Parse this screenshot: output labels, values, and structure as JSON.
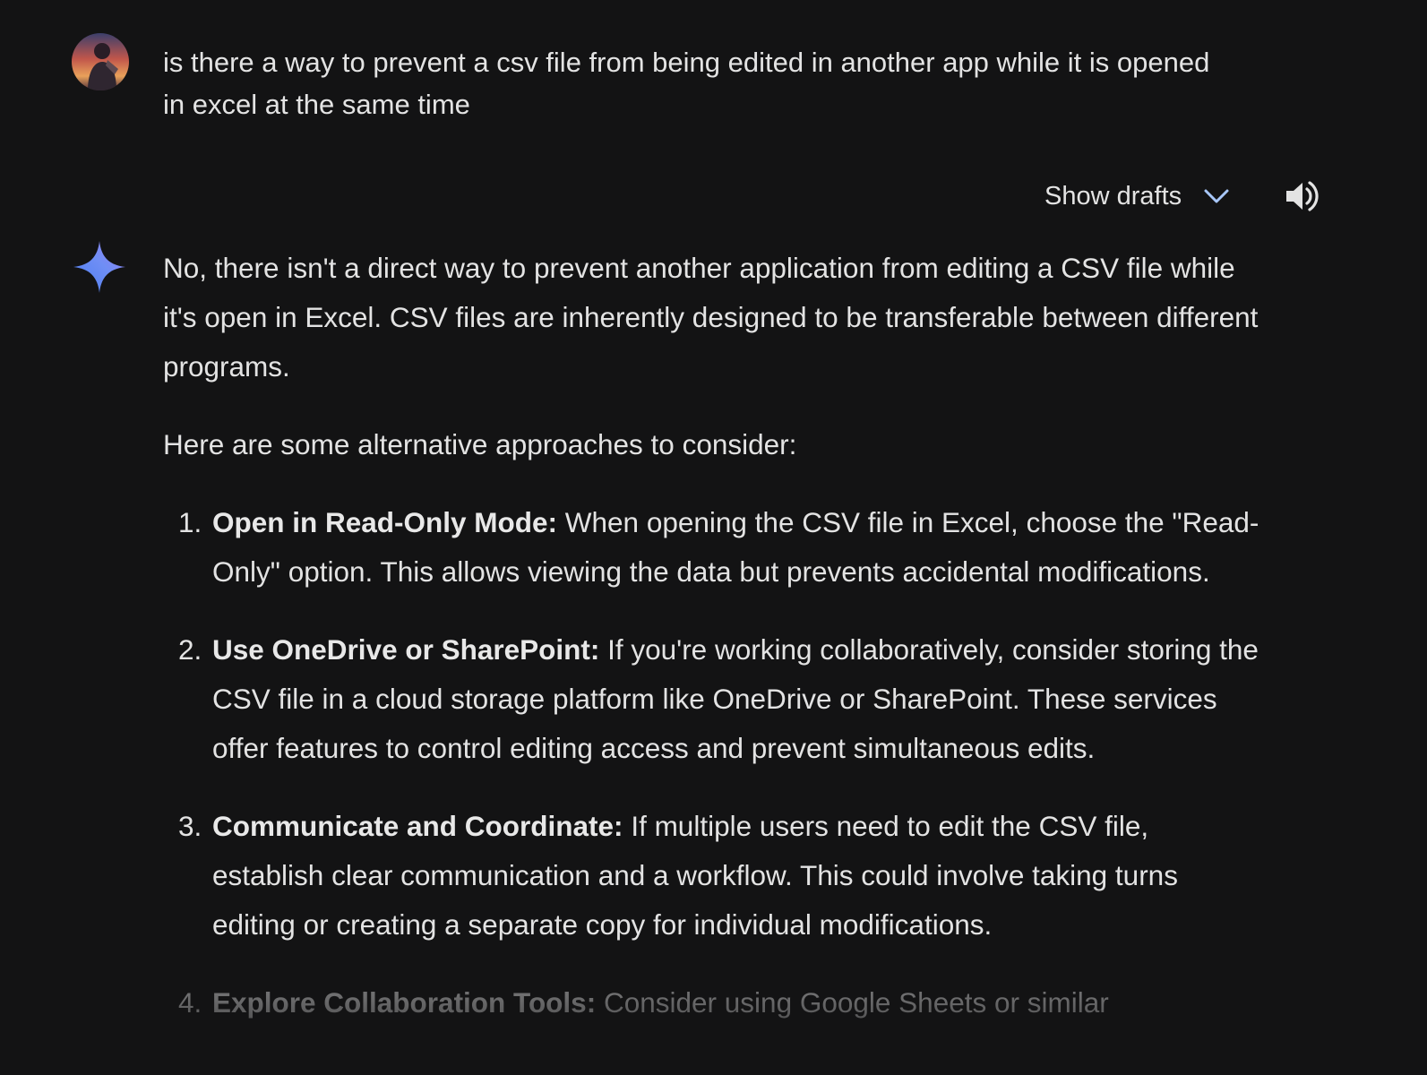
{
  "user": {
    "avatar_icon": "user-avatar",
    "query": "is there a way to prevent a csv file from being edited in another app while it is opened in excel at the same time"
  },
  "controls": {
    "show_drafts_label": "Show drafts",
    "chevron_icon": "chevron-down-icon",
    "speaker_icon": "volume-icon"
  },
  "response": {
    "spark_icon": "gemini-spark-icon",
    "intro": "No, there isn't a direct way to prevent another application from editing a CSV file while it's open in Excel. CSV files are inherently designed to be transferable between different programs.",
    "lead_in": "Here are some alternative approaches to consider:",
    "items": [
      {
        "number": "1.",
        "title": "Open in Read-Only Mode:",
        "text": "When opening the CSV file in Excel, choose the \"Read-Only\" option. This allows viewing the data but prevents accidental modifications."
      },
      {
        "number": "2.",
        "title": "Use OneDrive or SharePoint:",
        "text": "If you're working collaboratively, consider storing the CSV file in a cloud storage platform like OneDrive or SharePoint. These services offer features to control editing access and prevent simultaneous edits."
      },
      {
        "number": "3.",
        "title": "Communicate and Coordinate:",
        "text": "If multiple users need to edit the CSV file, establish clear communication and a workflow. This could involve taking turns editing or creating a separate copy for individual modifications."
      },
      {
        "number": "4.",
        "title": "Explore Collaboration Tools:",
        "text": "Consider using Google Sheets or similar"
      }
    ]
  },
  "colors": {
    "background": "#131314",
    "text": "#e3e3e3",
    "accent_chevron": "#a8c7fa"
  }
}
